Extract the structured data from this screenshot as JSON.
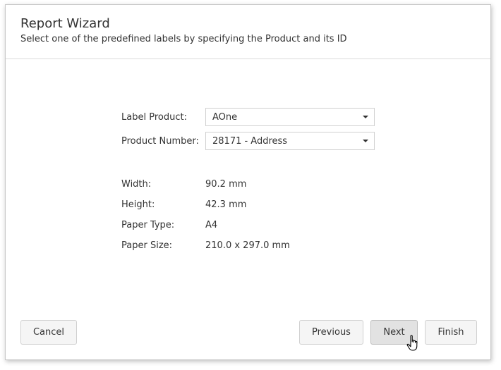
{
  "header": {
    "title": "Report Wizard",
    "subtitle": "Select one of the predefined labels by specifying the Product and its ID"
  },
  "form": {
    "label_product": {
      "label": "Label Product:",
      "value": "AOne"
    },
    "product_number": {
      "label": "Product Number:",
      "value": "28171 - Address"
    }
  },
  "details": [
    {
      "label": "Width:",
      "value": "90.2 mm"
    },
    {
      "label": "Height:",
      "value": "42.3 mm"
    },
    {
      "label": "Paper Type:",
      "value": "A4"
    },
    {
      "label": "Paper Size:",
      "value": "210.0 x 297.0 mm"
    }
  ],
  "buttons": {
    "cancel": "Cancel",
    "previous": "Previous",
    "next": "Next",
    "finish": "Finish"
  },
  "icons": {
    "dropdown": "chevron-down-icon",
    "cursor": "hand-pointer-icon"
  }
}
